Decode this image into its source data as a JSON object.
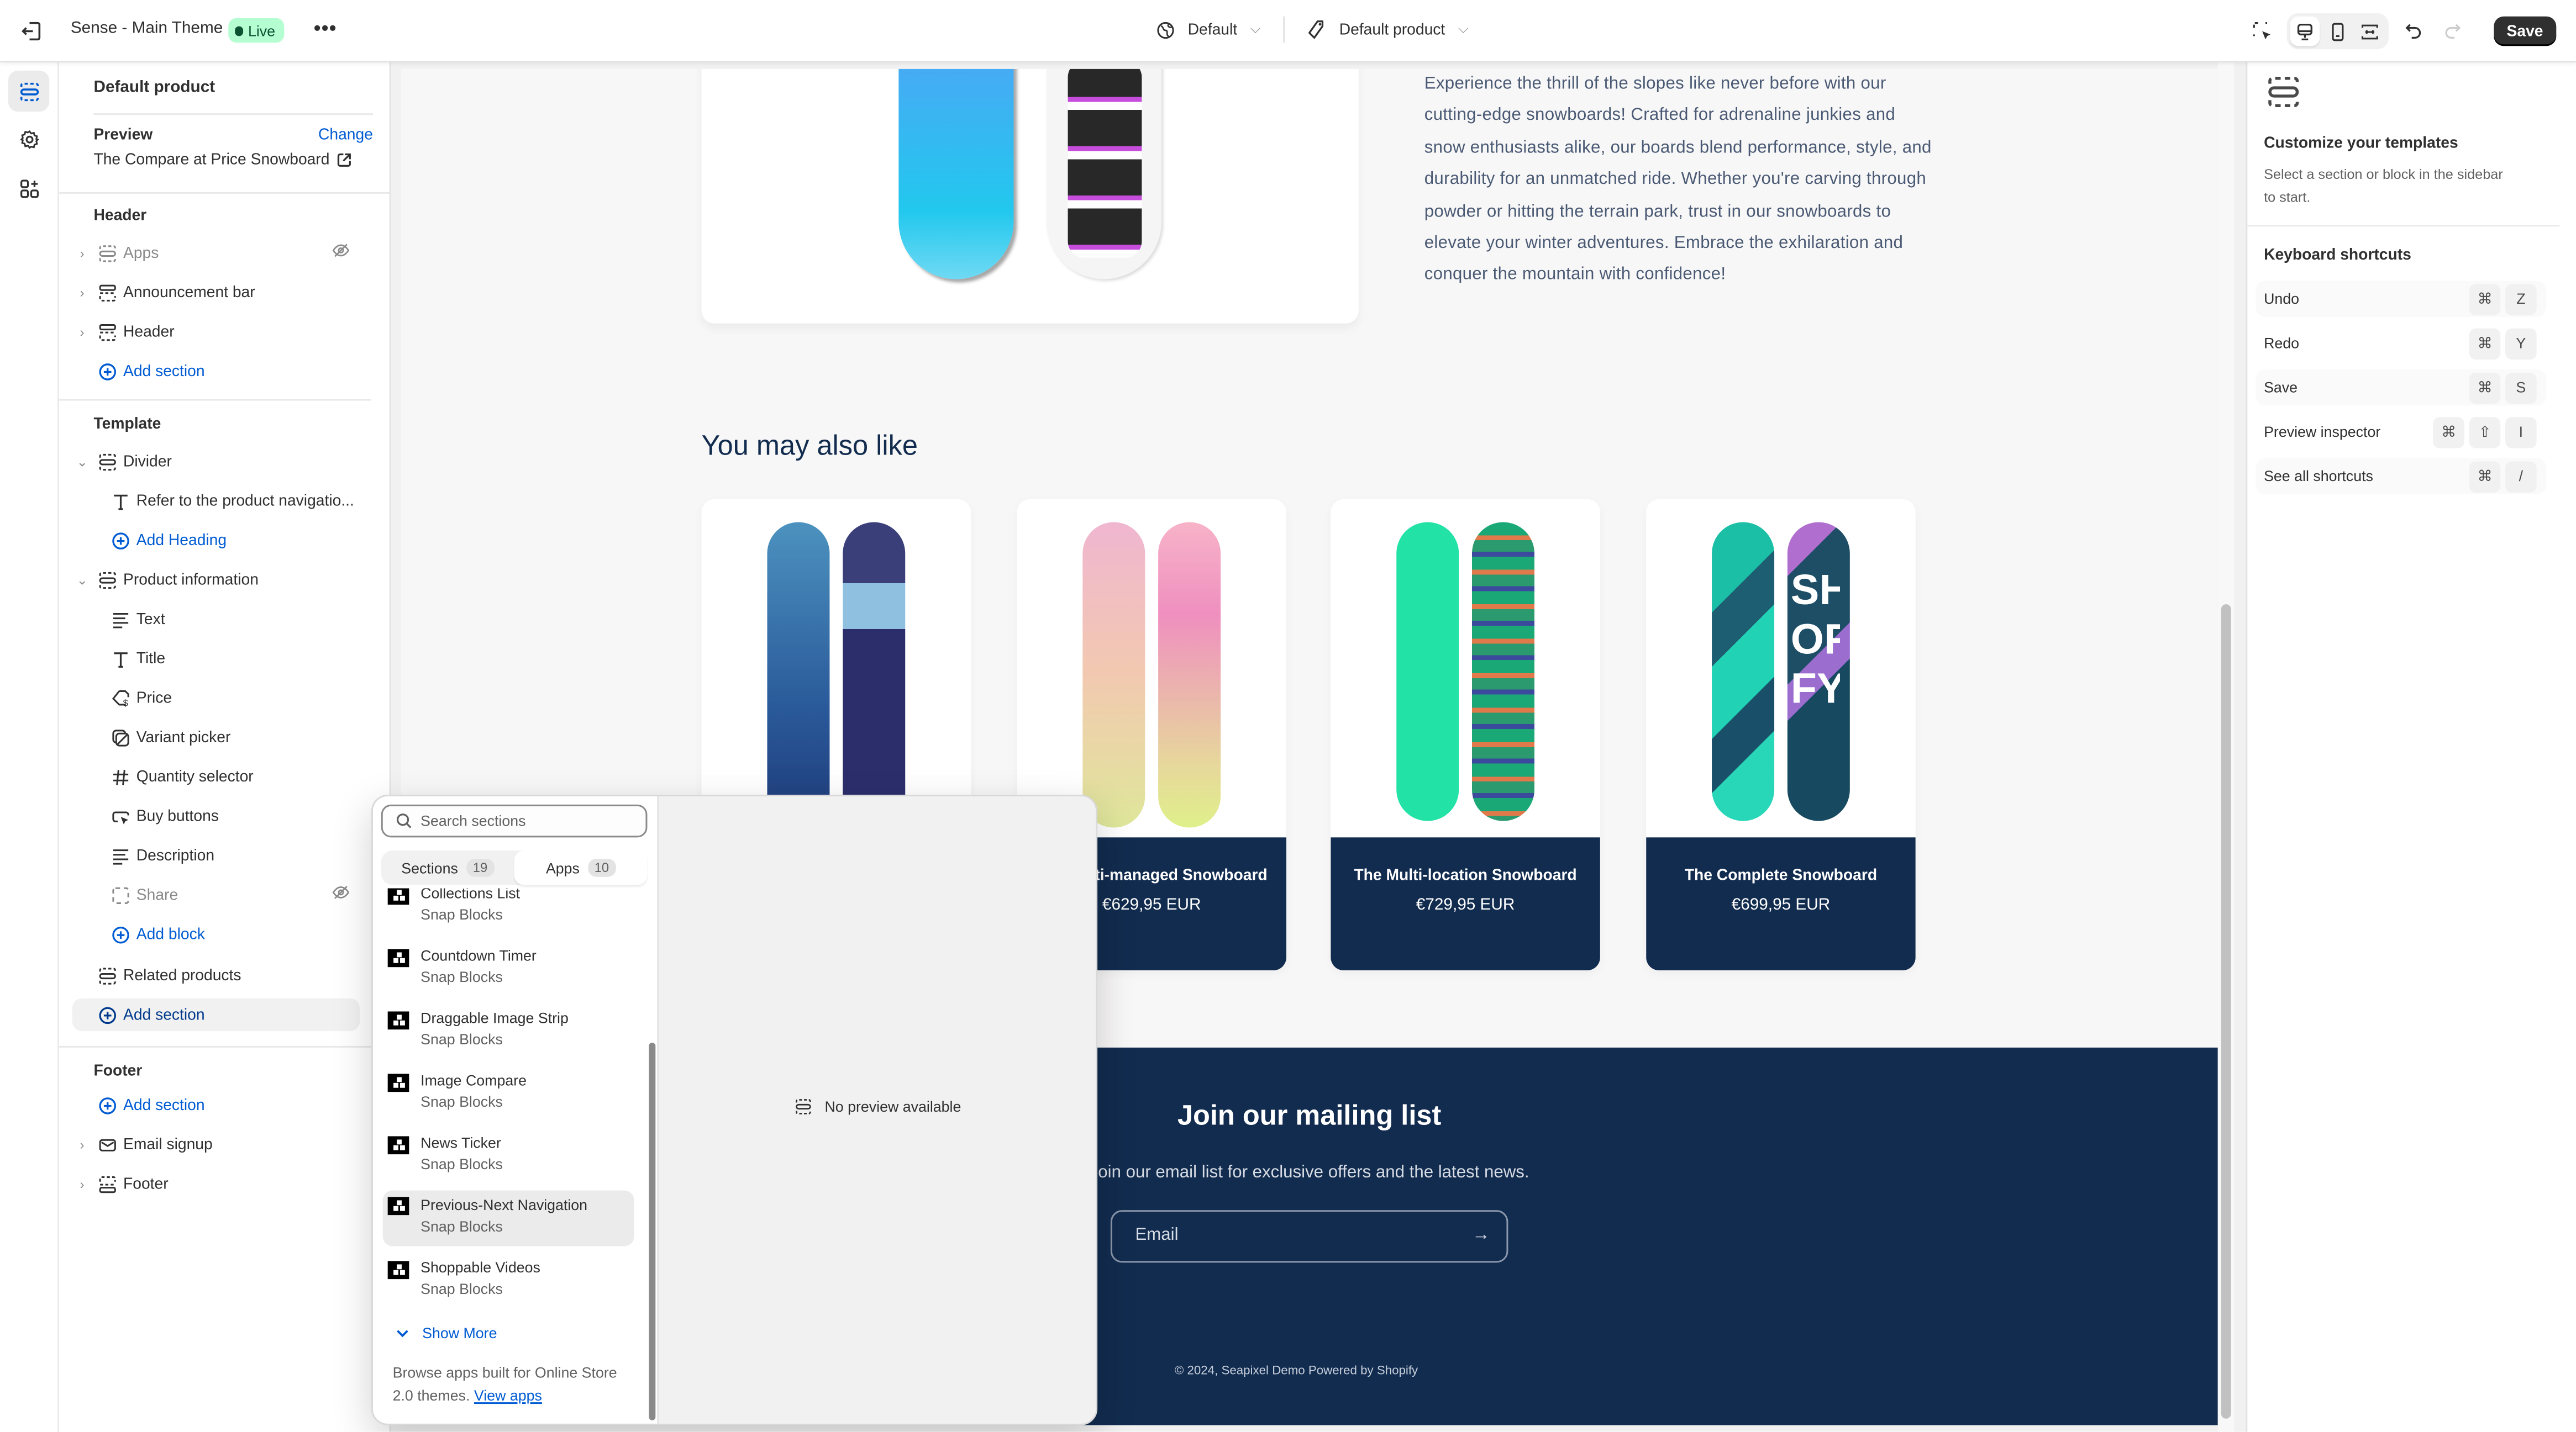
{
  "topbar": {
    "exit_icon": "exit-icon",
    "theme_name": "Sense - Main Theme",
    "live_badge": "Live",
    "more_label": "•••",
    "market_selector": "Default",
    "template_selector": "Default product",
    "save_label": "Save",
    "colors": {
      "live_bg": "#b4fed2",
      "live_text": "#0c5132",
      "save_bg": "#303030"
    }
  },
  "rail": {
    "items": [
      {
        "name": "sections",
        "icon": "sections-icon",
        "active": true
      },
      {
        "name": "theme-settings",
        "icon": "gear-icon",
        "active": false
      },
      {
        "name": "app-embeds",
        "icon": "apps-icon",
        "active": false
      }
    ]
  },
  "sidebar": {
    "title": "Default product",
    "preview_label": "Preview",
    "change_label": "Change",
    "preview_value": "The Compare at Price Snowboard",
    "header_group": {
      "title": "Header",
      "items": [
        {
          "label": "Apps",
          "icon": "section-icon",
          "hidden": true
        },
        {
          "label": "Announcement bar",
          "icon": "header-section-icon"
        },
        {
          "label": "Header",
          "icon": "header-section-icon"
        }
      ],
      "add_label": "Add section"
    },
    "template_group": {
      "title": "Template",
      "divider": {
        "label": "Divider",
        "blocks": [
          {
            "label": "Refer to the product navigatio...",
            "icon": "heading-icon"
          }
        ],
        "add_label": "Add Heading"
      },
      "product_info": {
        "label": "Product information",
        "blocks": [
          {
            "label": "Text",
            "icon": "text-icon"
          },
          {
            "label": "Title",
            "icon": "heading-icon"
          },
          {
            "label": "Price",
            "icon": "price-tag-icon"
          },
          {
            "label": "Variant picker",
            "icon": "variant-icon"
          },
          {
            "label": "Quantity selector",
            "icon": "hash-icon"
          },
          {
            "label": "Buy buttons",
            "icon": "cursor-button-icon"
          },
          {
            "label": "Description",
            "icon": "text-icon"
          },
          {
            "label": "Share",
            "icon": "share-frame-icon",
            "hidden": true
          }
        ],
        "add_label": "Add block"
      },
      "related": "Related products",
      "add_label": "Add section"
    },
    "footer_group": {
      "title": "Footer",
      "add_label": "Add section",
      "items": [
        {
          "label": "Email signup",
          "icon": "email-icon"
        },
        {
          "label": "Footer",
          "icon": "footer-section-icon"
        }
      ]
    }
  },
  "popover": {
    "search_placeholder": "Search sections",
    "tabs": [
      {
        "label": "Sections",
        "count": "19",
        "active": false
      },
      {
        "label": "Apps",
        "count": "10",
        "active": true
      }
    ],
    "items": [
      {
        "name": "Collections List",
        "app": "Snap Blocks"
      },
      {
        "name": "Countdown Timer",
        "app": "Snap Blocks"
      },
      {
        "name": "Draggable Image Strip",
        "app": "Snap Blocks"
      },
      {
        "name": "Image Compare",
        "app": "Snap Blocks"
      },
      {
        "name": "News Ticker",
        "app": "Snap Blocks"
      },
      {
        "name": "Previous-Next Navigation",
        "app": "Snap Blocks",
        "hovered": true
      },
      {
        "name": "Shoppable Videos",
        "app": "Snap Blocks"
      }
    ],
    "show_more": "Show More",
    "browse_text": "Browse apps built for Online Store 2.0 themes.",
    "view_apps": "View apps",
    "no_preview": "No preview available"
  },
  "preview": {
    "description": "Experience the thrill of the slopes like never before with our cutting-edge snowboards! Crafted for adrenaline junkies and snow enthusiasts alike, our boards blend performance, style, and durability for an unmatched ride. Whether you're carving through powder or hitting the terrain park, trust in our snowboards to elevate your winter adventures. Embrace the exhilaration and conquer the mountain with confidence!",
    "related_heading": "You may also like",
    "products": [
      {
        "name": "",
        "price": ""
      },
      {
        "name": "The Multi-managed Snowboard",
        "price": "€629,95 EUR"
      },
      {
        "name": "The Multi-location Snowboard",
        "price": "€729,95 EUR"
      },
      {
        "name": "The Complete Snowboard",
        "price": "€699,95 EUR"
      }
    ],
    "mailing": {
      "title": "Join our mailing list",
      "subtitle": "Join our email list for exclusive offers and the latest news.",
      "email_placeholder": "Email"
    },
    "copyright": "© 2024, Seapixel Demo Powered by Shopify",
    "colors": {
      "brand_navy": "#122c4f",
      "body_text": "#4a5a74",
      "page_bg": "#f8f7f7"
    }
  },
  "right_panel": {
    "title": "Customize your templates",
    "description": "Select a section or block in the sidebar to start.",
    "shortcuts_title": "Keyboard shortcuts",
    "shortcuts": [
      {
        "label": "Undo",
        "keys": [
          "⌘",
          "Z"
        ]
      },
      {
        "label": "Redo",
        "keys": [
          "⌘",
          "Y"
        ]
      },
      {
        "label": "Save",
        "keys": [
          "⌘",
          "S"
        ]
      },
      {
        "label": "Preview inspector",
        "keys": [
          "⌘",
          "⇧",
          "I"
        ]
      },
      {
        "label": "See all shortcuts",
        "keys": [
          "⌘",
          "/"
        ]
      }
    ]
  },
  "accent_color": "#005bd3"
}
